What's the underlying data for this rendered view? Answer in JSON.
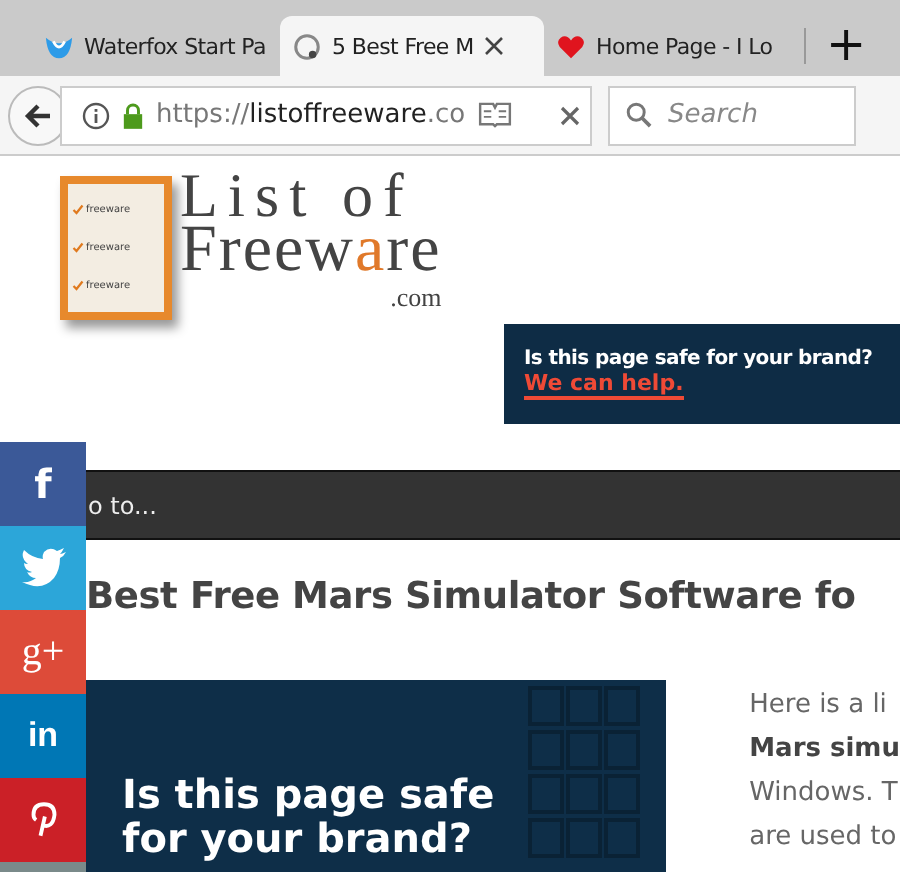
{
  "tabs": [
    {
      "title": "Waterfox Start Pa",
      "selected": false
    },
    {
      "title": "5 Best Free M",
      "selected": true
    },
    {
      "title": "Home Page - I Lo",
      "selected": false
    }
  ],
  "new_tab": "+",
  "address": {
    "scheme": "https://",
    "host": "listoffreeware",
    "rest": ".co"
  },
  "search": {
    "placeholder": "Search"
  },
  "logo": {
    "items": [
      "freeware",
      "freeware",
      "freeware"
    ],
    "line1": "List of",
    "line2_start": "Freew",
    "line2_accent": "a",
    "line2_end": "re",
    "line3": ".com"
  },
  "top_ad": {
    "line1": "Is this page safe for your brand?",
    "line2": "We can help."
  },
  "share": [
    {
      "kind": "facebook",
      "label": "f",
      "color": "#3b5998"
    },
    {
      "kind": "twitter",
      "color": "#2ca6d9"
    },
    {
      "kind": "googleplus",
      "label": "g+",
      "color": "#dd4b39"
    },
    {
      "kind": "linkedin",
      "label": "in",
      "color": "#0077b5"
    },
    {
      "kind": "pinterest",
      "color": "#cb2027"
    }
  ],
  "menu_bar": "o to...",
  "heading": "Best Free Mars Simulator Software fo",
  "ad": {
    "text": "Is this page safe for your brand?"
  },
  "intro_lines": [
    "Here is a li",
    "**Mars simu**",
    "Windows. T",
    "are used to"
  ]
}
